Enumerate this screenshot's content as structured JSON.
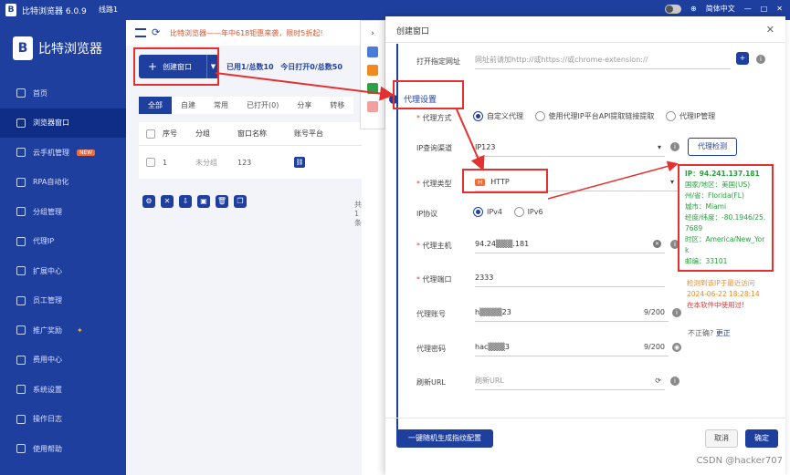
{
  "titlebar": {
    "app_title": "比特浏览器 6.0.9",
    "line": "线路1",
    "language": "简体中文",
    "logo": "B"
  },
  "sidebar": {
    "brand": "比特浏览器",
    "items": [
      {
        "label": "首页",
        "icon": "home-icon"
      },
      {
        "label": "浏览器窗口",
        "icon": "window-icon",
        "active": true
      },
      {
        "label": "云手机管理",
        "icon": "phone-icon",
        "badge": "NEW"
      },
      {
        "label": "RPA自动化",
        "icon": "robot-icon"
      },
      {
        "label": "分组管理",
        "icon": "group-icon"
      },
      {
        "label": "代理IP",
        "icon": "proxy-icon"
      },
      {
        "label": "扩展中心",
        "icon": "extension-icon"
      },
      {
        "label": "员工管理",
        "icon": "staff-icon"
      },
      {
        "label": "推广奖励",
        "icon": "gift-icon"
      },
      {
        "label": "费用中心",
        "icon": "fee-icon"
      },
      {
        "label": "系统设置",
        "icon": "settings-icon"
      },
      {
        "label": "操作日志",
        "icon": "log-icon"
      },
      {
        "label": "使用帮助",
        "icon": "help-icon"
      }
    ]
  },
  "main": {
    "notice": "比特浏览器——年中618钜惠来袭，限时5折起!",
    "create_btn": "创建窗口",
    "stats_used": "已用1/总数10",
    "stats_today": "今日打开0/总数50",
    "tabs": [
      "全部",
      "自建",
      "常用",
      "已打开(0)",
      "分享",
      "转移"
    ],
    "columns": [
      "序号",
      "分组",
      "窗口名称",
      "账号平台"
    ],
    "rows": [
      {
        "index": "1",
        "group": "未分组",
        "name": "123"
      }
    ],
    "pager_text": "共 1 条"
  },
  "dialog": {
    "title": "创建窗口",
    "url_label": "打开指定网址",
    "url_placeholder": "网址前请加http://或https://或chrome-extension://",
    "section_title": "代理设置",
    "proxy_mode_label": "代理方式",
    "proxy_modes": [
      "自定义代理",
      "使用代理IP平台API提取链接提取",
      "代理IP管理"
    ],
    "ip_channel_label": "IP查询渠道",
    "ip_channel_value": "IP123",
    "check_btn": "代理检测",
    "proxy_type_label": "代理类型",
    "proxy_type_value": "HTTP",
    "proxy_type_icon": "H",
    "ip_protocol_label": "IP协议",
    "ip_protocols": [
      "IPv4",
      "IPv6"
    ],
    "host_label": "代理主机",
    "host_value": "94.24▒▒▒.181",
    "port_label": "代理端口",
    "port_value": "2333",
    "account_label": "代理账号",
    "account_value": "h▒▒▒▒23",
    "account_count": "9/200",
    "password_label": "代理密码",
    "password_value": "hac▒▒▒3",
    "password_count": "9/200",
    "refresh_label": "刷新URL",
    "refresh_placeholder": "刷新URL",
    "result": {
      "ip": "IP：94.241.137.181",
      "country": "国家/地区：美国(US)",
      "state": "州/省：Florida(FL)",
      "city": "城市：Miami",
      "coords": "经度/纬度：-80.1946/25.7689",
      "timezone": "时区：America/New_York",
      "zip": "邮编：33101"
    },
    "warn_line1": "检测到该IP于最近访问",
    "warn_time": "2024-06-22 18:28:14",
    "warn_line3": "在本软件中使用过!",
    "incorrect": "不正确?",
    "fix": "更正",
    "gen_btn": "一键随机生成指纹配置",
    "cancel": "取消",
    "ok": "确定"
  },
  "watermark": "CSDN @hacker707",
  "colors": {
    "brand": "#1e3f9e",
    "annotation": "#e53030",
    "success": "#23a23a",
    "warning": "#f08a1e"
  }
}
